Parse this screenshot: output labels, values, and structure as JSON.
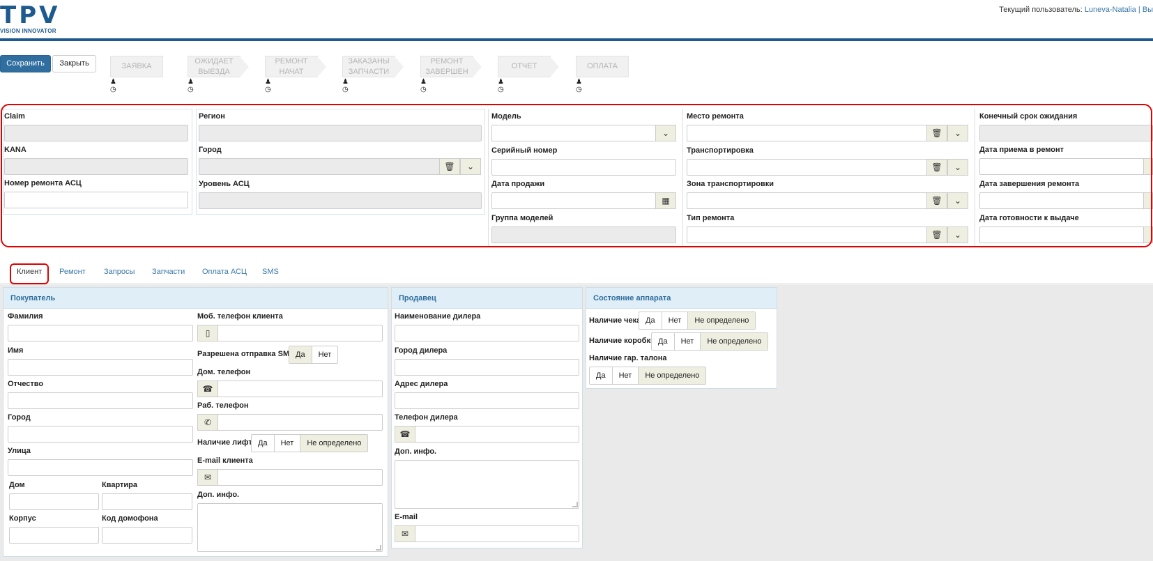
{
  "logo": {
    "text": "TPV",
    "sub": "VISION INNOVATOR"
  },
  "user": {
    "label": "Текущий пользователь:",
    "name": "Luneva-Natalia",
    "sep": "|",
    "more": "Вы"
  },
  "toolbar": {
    "save": "Сохранить",
    "close": "Закрыть"
  },
  "stages": [
    "ЗАЯВКА",
    "ОЖИДАЕТ ВЫЕЗДА",
    "РЕМОНТ НАЧАТ",
    "ЗАКАЗАНЫ ЗАПЧАСТИ",
    "РЕМОНТ ЗАВЕРШЕН",
    "ОТЧЕТ",
    "ОПЛАТА"
  ],
  "stage_icons": {
    "user": "user-icon",
    "clock": "clock-icon"
  },
  "header_form": {
    "claim": "Claim",
    "kana": "KANA",
    "repair_no": "Номер ремонта АСЦ",
    "region": "Регион",
    "city": "Город",
    "level": "Уровень АСЦ",
    "model": "Модель",
    "serial": "Серийный номер",
    "sale_date": "Дата продажи",
    "model_group": "Группа моделей",
    "place": "Место ремонта",
    "transport": "Транспортировка",
    "transport_zone": "Зона транспортировки",
    "repair_type": "Тип ремонта",
    "deadline": "Конечный срок ожидания",
    "accept_date": "Дата приема в ремонт",
    "finish_date": "Дата завершения ремонта",
    "ready_date": "Дата готовности к выдаче"
  },
  "tabs": [
    "Клиент",
    "Ремонт",
    "Запросы",
    "Запчасти",
    "Оплата АСЦ",
    "SMS"
  ],
  "buyer": {
    "title": "Покупатель",
    "last_name": "Фамилия",
    "first_name": "Имя",
    "middle_name": "Отчество",
    "city": "Город",
    "street": "Улица",
    "house": "Дом",
    "flat": "Квартира",
    "building": "Корпус",
    "intercom": "Код домофона",
    "mobile": "Моб. телефон клиента",
    "sms_allowed": "Разрешена отправка SMS",
    "home_phone": "Дом. телефон",
    "work_phone": "Раб. телефон",
    "lift": "Наличие лифта",
    "email": "E-mail клиента",
    "extra": "Доп. инфо."
  },
  "seller": {
    "title": "Продавец",
    "dealer_name": "Наименование дилера",
    "dealer_city": "Город дилера",
    "dealer_address": "Адрес дилера",
    "dealer_phone": "Телефон дилера",
    "extra": "Доп. инфо.",
    "email": "E-mail"
  },
  "device": {
    "title": "Состояние аппарата",
    "receipt": "Наличие чека",
    "box": "Наличие коробки",
    "warranty": "Наличие гар. талона"
  },
  "options": {
    "yes": "Да",
    "no": "Нет",
    "undefined": "Не определено"
  },
  "colors": {
    "brand": "#1d5a8f",
    "primary": "#2f6e9e",
    "highlight": "#e00000",
    "panel_header": "#dfeef7"
  }
}
